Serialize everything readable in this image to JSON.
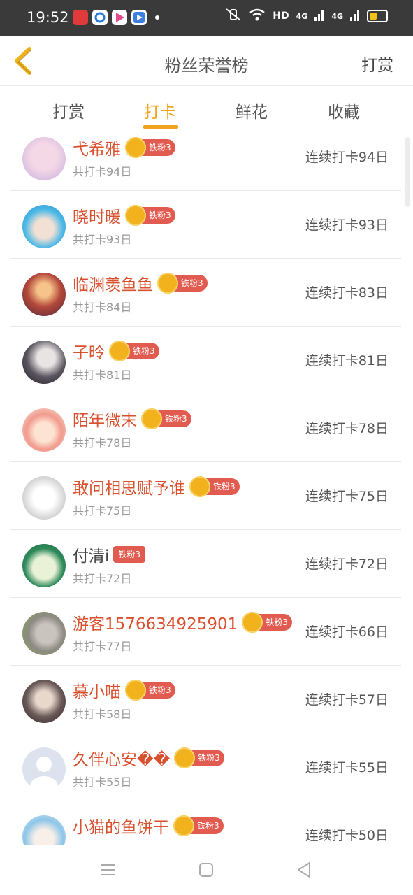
{
  "status": {
    "time": "19:52",
    "network": "HD",
    "signal1": "4G",
    "signal2": "4G",
    "app_icons": [
      "heart-app-icon",
      "blue-app-icon",
      "video-app-icon",
      "player-app-icon"
    ]
  },
  "header": {
    "title": "粉丝荣誉榜",
    "action": "打赏",
    "back_icon": "chevron-left-icon",
    "accent": "#f0a31c"
  },
  "tabs": [
    {
      "label": "打赏",
      "active": false
    },
    {
      "label": "打卡",
      "active": true
    },
    {
      "label": "鲜花",
      "active": false
    },
    {
      "label": "收藏",
      "active": false
    }
  ],
  "fans": [
    {
      "name": "弋希雅",
      "badge": "铁粉3",
      "crown": true,
      "total": "共打卡94日",
      "streak": "连续打卡94日"
    },
    {
      "name": "晓时暖",
      "badge": "铁粉3",
      "crown": true,
      "total": "共打卡93日",
      "streak": "连续打卡93日"
    },
    {
      "name": "临渊羡鱼鱼",
      "badge": "铁粉3",
      "crown": true,
      "total": "共打卡84日",
      "streak": "连续打卡83日"
    },
    {
      "name": "子昤",
      "badge": "铁粉3",
      "crown": true,
      "total": "共打卡81日",
      "streak": "连续打卡81日"
    },
    {
      "name": "陌年微末",
      "badge": "铁粉3",
      "crown": true,
      "total": "共打卡78日",
      "streak": "连续打卡78日"
    },
    {
      "name": "敢问相思赋予谁",
      "badge": "铁粉3",
      "crown": true,
      "total": "共打卡75日",
      "streak": "连续打卡75日"
    },
    {
      "name": "付清i",
      "badge": "铁粉3",
      "crown": false,
      "total": "共打卡72日",
      "streak": "连续打卡72日"
    },
    {
      "name": "游客1576634925901",
      "badge": "铁粉3",
      "crown": true,
      "total": "共打卡77日",
      "streak": "连续打卡66日"
    },
    {
      "name": "慕小喵",
      "badge": "铁粉3",
      "crown": true,
      "total": "共打卡58日",
      "streak": "连续打卡57日"
    },
    {
      "name": "久伴心安��",
      "badge": "铁粉3",
      "crown": true,
      "total": "共打卡55日",
      "streak": "连续打卡55日"
    },
    {
      "name": "小猫的鱼饼干",
      "badge": "铁粉3",
      "crown": true,
      "total": "",
      "streak": "连续打卡50日"
    }
  ],
  "colors": {
    "name": "#d9502f",
    "badge": "#e25b50",
    "crown": "#f2b21e"
  },
  "nav": [
    "menu-icon",
    "home-icon",
    "back-triangle-icon"
  ]
}
